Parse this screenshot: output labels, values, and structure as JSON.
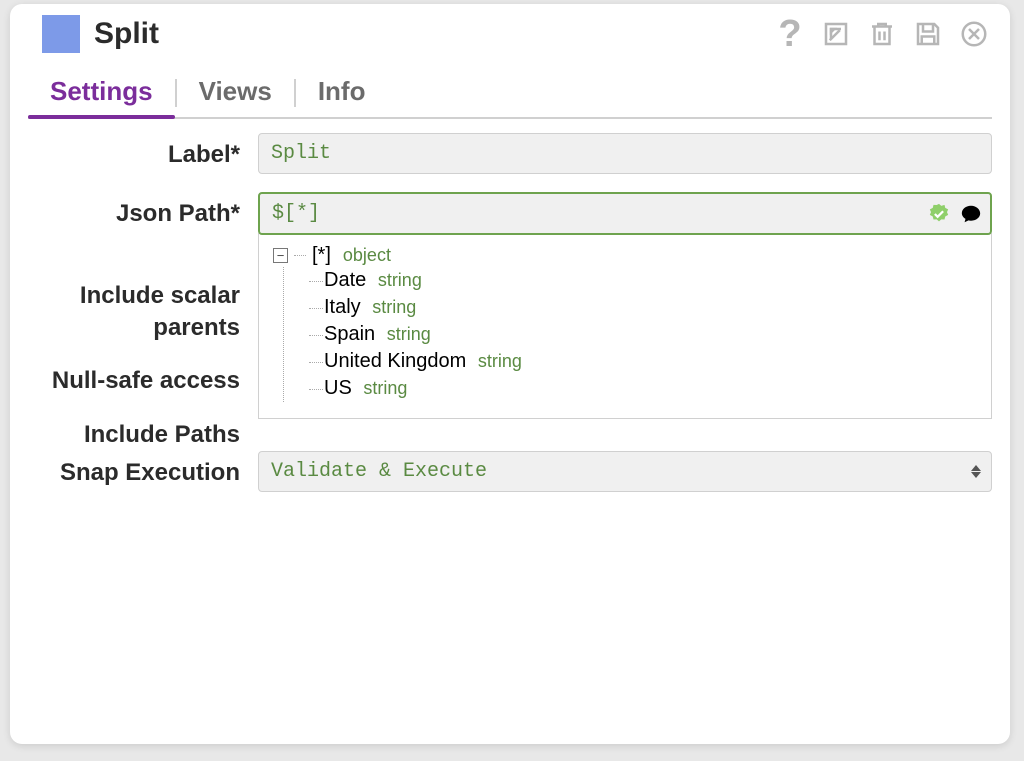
{
  "header": {
    "title": "Split",
    "icon": "snap-square-icon",
    "help_icon": "help-icon",
    "detach_icon": "open-external-icon",
    "delete_icon": "trash-icon",
    "save_icon": "save-icon",
    "close_icon": "close-icon"
  },
  "tabs": [
    {
      "id": "settings",
      "label": "Settings",
      "active": true
    },
    {
      "id": "views",
      "label": "Views",
      "active": false
    },
    {
      "id": "info",
      "label": "Info",
      "active": false
    }
  ],
  "form": {
    "label_field_label": "Label*",
    "label_value": "Split",
    "jsonpath_label": "Json Path*",
    "jsonpath_value": "$[*]",
    "include_scalar_parents_label": "Include scalar parents",
    "nullsafe_label": "Null-safe access",
    "include_paths_label": "Include Paths",
    "snap_execution_label": "Snap Execution",
    "snap_execution_value": "Validate & Execute"
  },
  "tree": {
    "root_label": "[*]",
    "root_type": "object",
    "children": [
      {
        "name": "Date",
        "type": "string"
      },
      {
        "name": "Italy",
        "type": "string"
      },
      {
        "name": "Spain",
        "type": "string"
      },
      {
        "name": "United Kingdom",
        "type": "string"
      },
      {
        "name": "US",
        "type": "string"
      }
    ]
  }
}
